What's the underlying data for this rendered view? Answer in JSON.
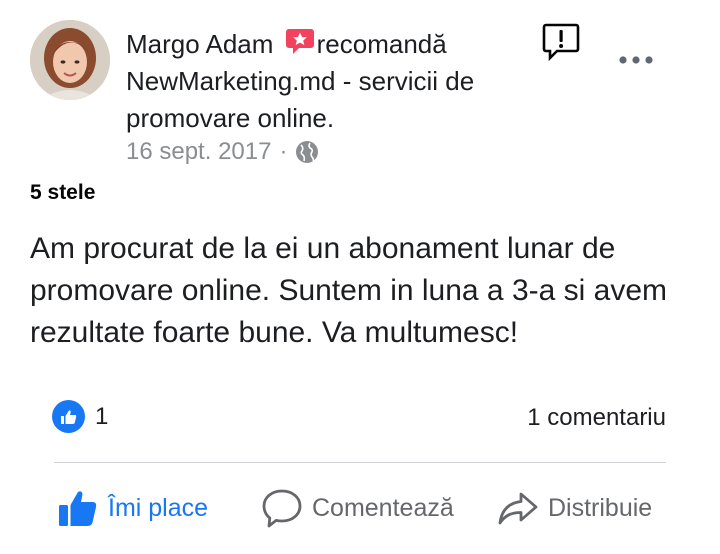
{
  "post": {
    "author": "Margo Adam",
    "verb": "recomandă",
    "page_name": "NewMarketing.md - servicii de promovare online.",
    "date": "16 sept. 2017",
    "separator": "·",
    "rating": "5 stele",
    "body": "Am procurat de la ei un abonament lunar de promovare online. Suntem in luna a 3-a si avem rezultate foarte bune. Va multumesc!"
  },
  "stats": {
    "reaction_count": "1",
    "comments": "1 comentariu"
  },
  "actions": {
    "like": "Îmi place",
    "comment": "Comentează",
    "share": "Distribuie"
  },
  "colors": {
    "brand_blue": "#1877f2",
    "recommend_red": "#f3425f",
    "muted_gray": "#65676b"
  },
  "icons": [
    "recommend-icon",
    "report-icon",
    "more-icon",
    "globe-icon",
    "like-reaction-icon",
    "thumbs-up-icon",
    "comment-icon",
    "share-icon"
  ]
}
